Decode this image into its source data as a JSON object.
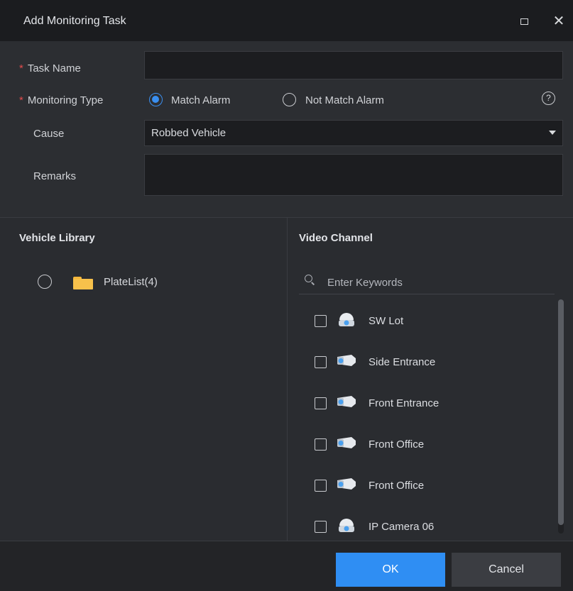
{
  "window": {
    "title": "Add Monitoring Task",
    "maximize_icon": "maximize-icon",
    "close_glyph": "✕"
  },
  "form": {
    "required_mark": "*",
    "task_name_label": "Task Name",
    "task_name_value": "",
    "monitoring_type_label": "Monitoring Type",
    "options": [
      "Match Alarm",
      "Not Match Alarm"
    ],
    "selected_option": "Match Alarm",
    "help_glyph": "?",
    "cause_label": "Cause",
    "cause_value": "Robbed Vehicle",
    "remarks_label": "Remarks",
    "remarks_value": ""
  },
  "vehicle_library": {
    "title": "Vehicle Library",
    "items": [
      {
        "label": "PlateList(4)",
        "icon": "folder-icon"
      }
    ]
  },
  "video_channel": {
    "title": "Video Channel",
    "search_placeholder": "Enter Keywords",
    "channels": [
      {
        "label": "SW Lot",
        "icon": "dome-camera-icon",
        "checked": false
      },
      {
        "label": "Side Entrance",
        "icon": "bullet-camera-icon",
        "checked": false
      },
      {
        "label": "Front Entrance",
        "icon": "bullet-camera-icon",
        "checked": false
      },
      {
        "label": "Front Office",
        "icon": "bullet-camera-icon",
        "checked": false
      },
      {
        "label": "Front Office",
        "icon": "bullet-camera-icon",
        "checked": false
      },
      {
        "label": "IP Camera 06",
        "icon": "dome-camera-icon",
        "checked": false
      }
    ]
  },
  "footer": {
    "ok_label": "OK",
    "cancel_label": "Cancel"
  },
  "colors": {
    "accent": "#2f8ef3",
    "required": "#e04c4c",
    "folder": "#f7c14b",
    "camera": "#4aa0ef"
  }
}
